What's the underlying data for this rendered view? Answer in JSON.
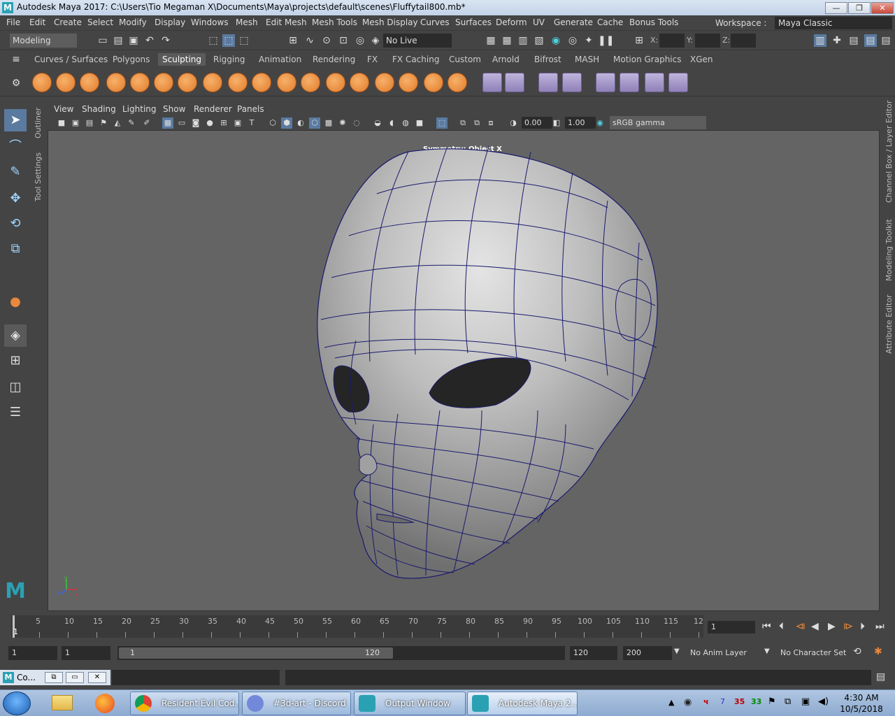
{
  "window": {
    "title": "Autodesk Maya 2017: C:\\Users\\Tio Megaman X\\Documents\\Maya\\projects\\default\\scenes\\Fluffytail800.mb*",
    "app_icon_letter": "M",
    "buttons": {
      "minimize": "—",
      "restore": "❐",
      "close": "✕"
    }
  },
  "menubar": {
    "items": [
      "File",
      "Edit",
      "Create",
      "Select",
      "Modify",
      "Display",
      "Windows",
      "Mesh",
      "Edit Mesh",
      "Mesh Tools",
      "Mesh Display",
      "Curves",
      "Surfaces",
      "Deform",
      "UV",
      "Generate",
      "Cache",
      "Bonus Tools"
    ],
    "workspace_label": "Workspace :",
    "workspace_value": "Maya Classic"
  },
  "statusline": {
    "mode": "Modeling",
    "live_surface": "No Live Surface",
    "x_label": "X:",
    "y_label": "Y:",
    "z_label": "Z:"
  },
  "shelf": {
    "tabs": [
      "Curves / Surfaces",
      "Polygons",
      "Sculpting",
      "Rigging",
      "Animation",
      "Rendering",
      "FX",
      "FX Caching",
      "Custom",
      "Arnold",
      "Bifrost",
      "MASH",
      "Motion Graphics",
      "XGen"
    ],
    "active_tab": "Sculpting"
  },
  "side_panels": {
    "outliner": "Outliner",
    "tool_settings": "Tool Settings",
    "channel_box": "Channel Box / Layer Editor",
    "modeling_toolkit": "Modeling Toolkit",
    "attribute_editor": "Attribute Editor"
  },
  "viewport": {
    "menus": [
      "View",
      "Shading",
      "Lighting",
      "Show",
      "Renderer",
      "Panels"
    ],
    "exposure": "0.00",
    "gamma": "1.00",
    "color_space": "sRGB gamma",
    "symmetry_label": "Symmetry: Object X",
    "axis": {
      "x": "x",
      "y": "y",
      "z": "z"
    }
  },
  "timeline": {
    "ticks": [
      "5",
      "10",
      "15",
      "20",
      "25",
      "30",
      "35",
      "40",
      "45",
      "50",
      "55",
      "60",
      "65",
      "70",
      "75",
      "80",
      "85",
      "90",
      "95",
      "100",
      "105",
      "110",
      "115",
      "12"
    ],
    "current_frame_marker": "1",
    "current_frame": "1"
  },
  "range": {
    "start": "1",
    "playback_start": "1",
    "slider_start": "1",
    "slider_end": "120",
    "playback_end": "120",
    "end": "200",
    "anim_layer": "No Anim Layer",
    "character_set": "No Character Set"
  },
  "commandline": {
    "mini_label": "Co..."
  },
  "taskbar": {
    "tasks": [
      "Resident Evil Cod...",
      "#3d-art - Discord",
      "Output Window",
      "Autodesk Maya 2..."
    ],
    "tray_numbers": [
      "7",
      "35",
      "33"
    ],
    "time": "4:30 AM",
    "date": "10/5/2018"
  },
  "colors": {
    "maya_blue": "#2aa1b3",
    "wireframe": "#1a1a6e",
    "viewport_bg": "#646464",
    "shelf_orange": "#e9883d"
  }
}
